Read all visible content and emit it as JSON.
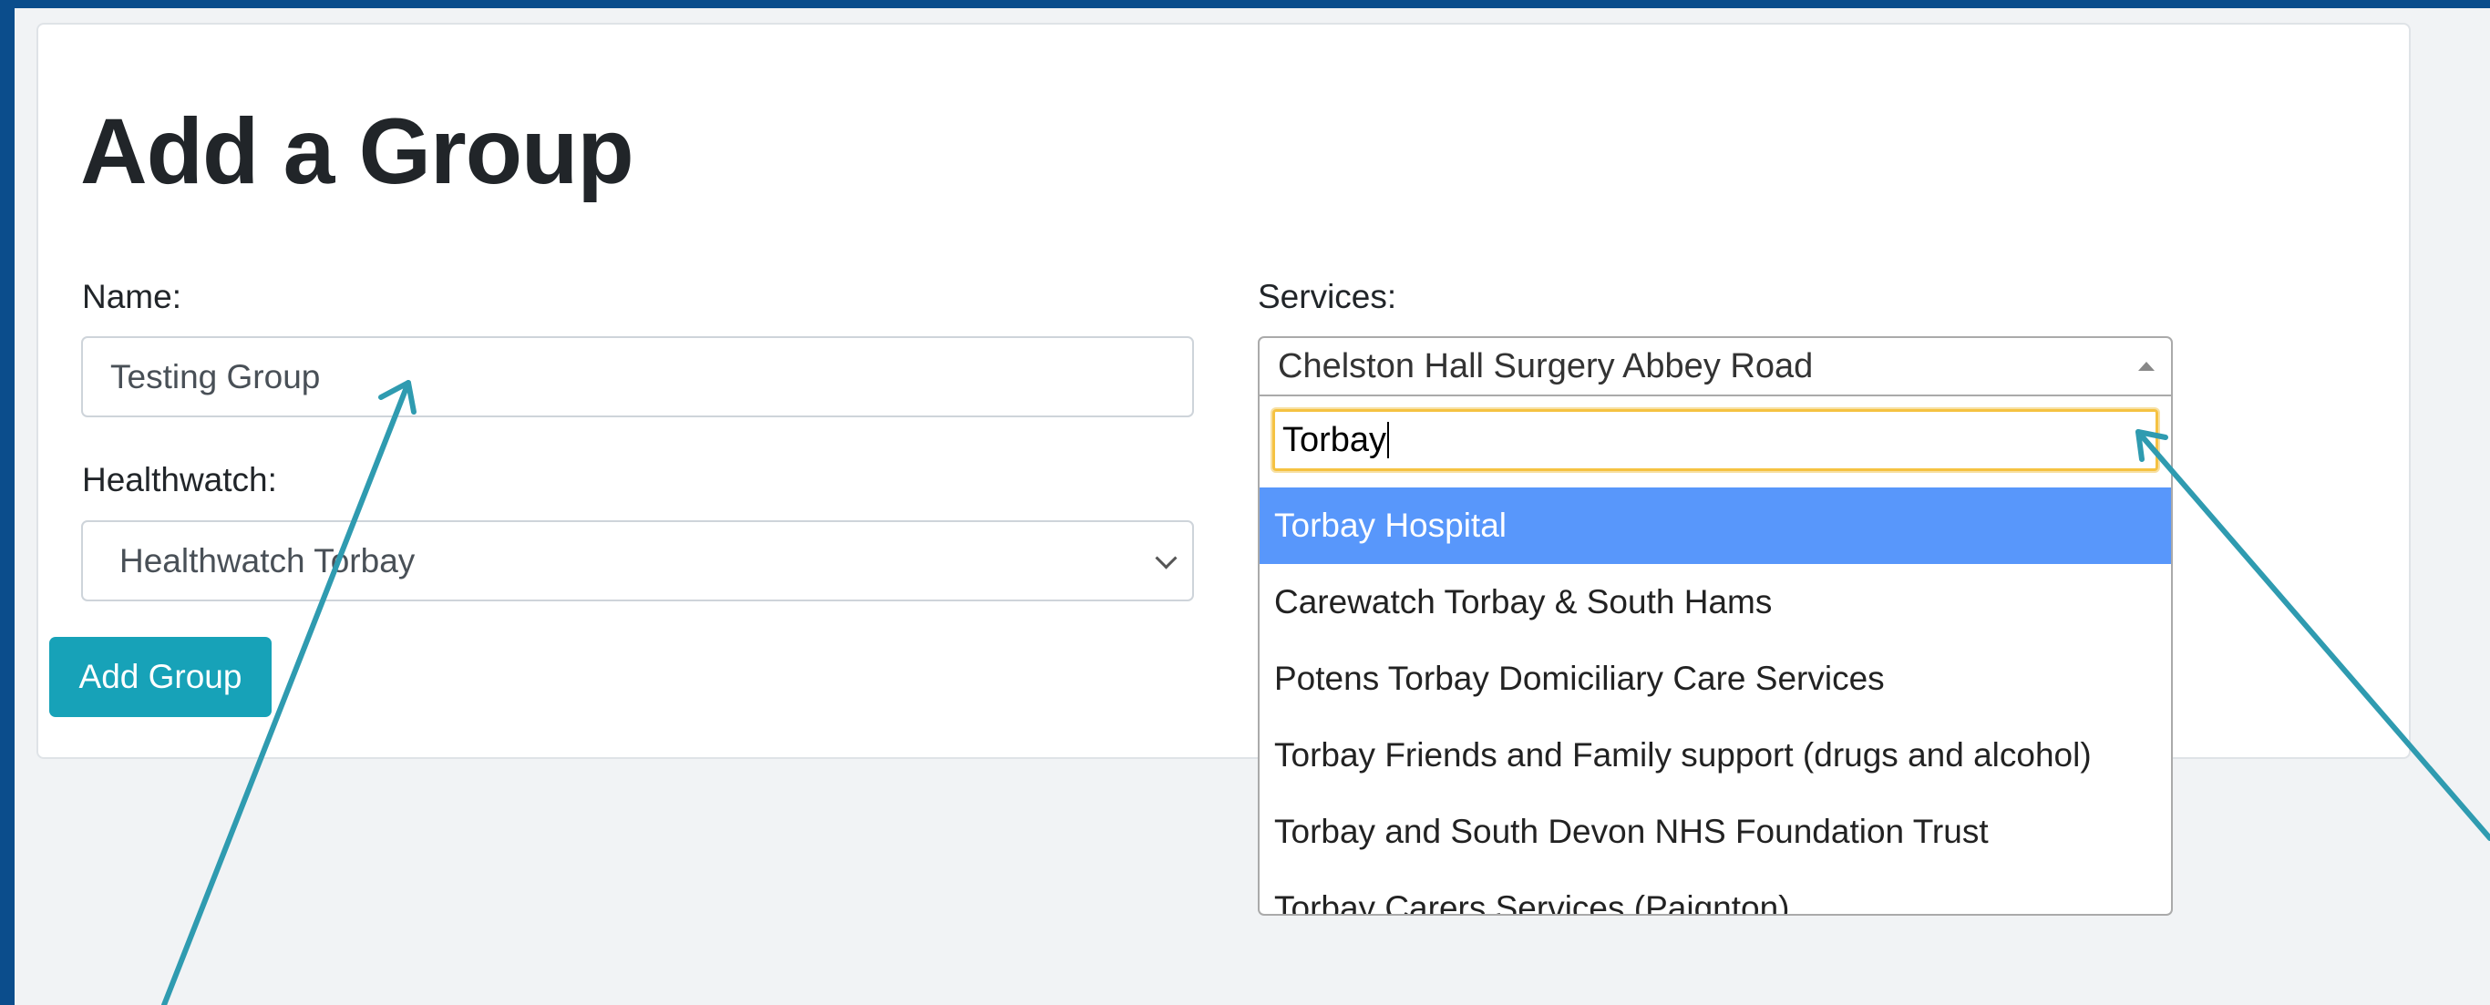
{
  "page": {
    "title": "Add a Group"
  },
  "form": {
    "name": {
      "label": "Name:",
      "value": "Testing Group"
    },
    "healthwatch": {
      "label": "Healthwatch:",
      "selected": "Healthwatch Torbay"
    },
    "services": {
      "label": "Services:",
      "selected": "Chelston Hall Surgery Abbey Road",
      "search_value": "Torbay",
      "options": [
        {
          "label": "Torbay Hospital",
          "highlighted": true
        },
        {
          "label": "Carewatch Torbay & South Hams",
          "highlighted": false
        },
        {
          "label": "Potens Torbay Domiciliary Care Services",
          "highlighted": false
        },
        {
          "label": "Torbay Friends and Family support (drugs and alcohol)",
          "highlighted": false
        },
        {
          "label": "Torbay and South Devon NHS Foundation Trust",
          "highlighted": false
        },
        {
          "label": "Torbay Carers Services (Paignton)",
          "highlighted": false
        }
      ]
    },
    "submit_label": "Add Group"
  },
  "colors": {
    "frame": "#0b4d8c",
    "button": "#17a2b8",
    "highlight": "#5897fb",
    "annotation_arrow": "#2f9bb0",
    "focus_ring": "#f5c242"
  },
  "annotations": [
    {
      "name": "arrow-to-name-field",
      "target": "name-input"
    },
    {
      "name": "arrow-to-services-search",
      "target": "services-search-input"
    }
  ]
}
